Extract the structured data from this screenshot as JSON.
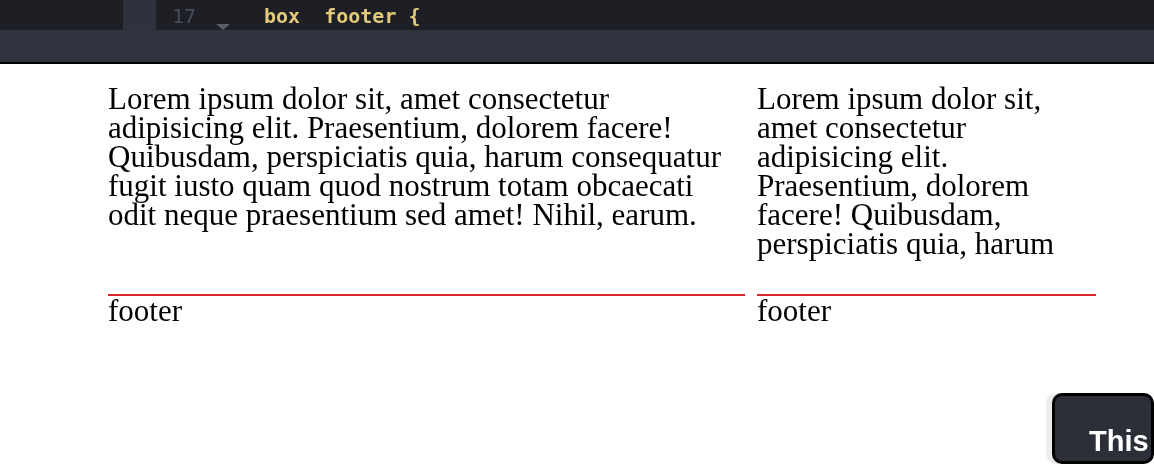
{
  "editor": {
    "line_number": "17",
    "code": "box  footer {"
  },
  "columns": [
    {
      "text": "Lorem ipsum dolor sit, amet consectetur adipisicing elit. Praesentium, dolorem facere! Quibusdam, perspiciatis quia, harum consequatur fugit iusto quam quod nostrum totam obcaecati odit neque praesentium sed amet! Nihil, earum.",
      "footer": "footer"
    },
    {
      "text": "Lorem ipsum dolor sit, amet consectetur adipisicing elit. Praesentium, dolorem facere! Quibusdam, perspiciatis quia, harum",
      "footer": "footer"
    }
  ],
  "popup": {
    "title": "This"
  }
}
